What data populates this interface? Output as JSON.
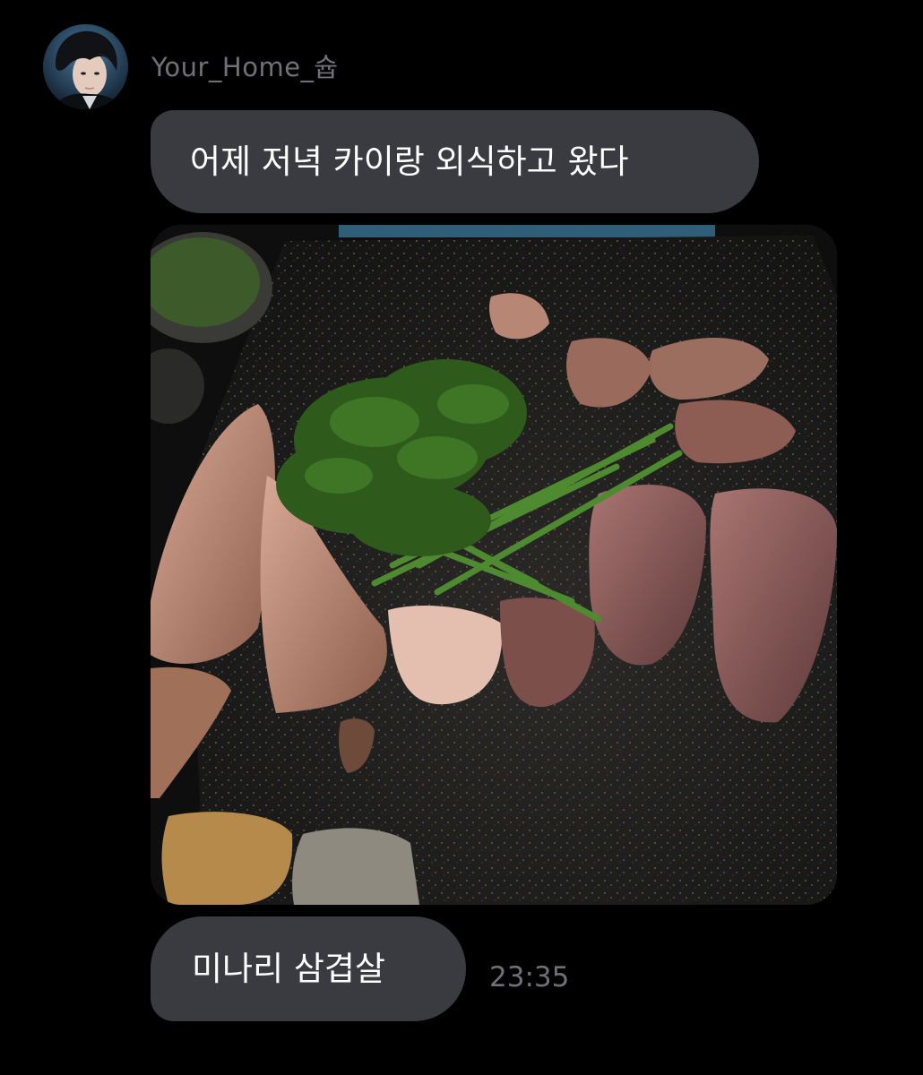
{
  "chat": {
    "sender": {
      "name": "Your_Home_슙",
      "avatar_icon": "avatar"
    },
    "messages": [
      {
        "type": "text",
        "text": "어제 저녁 카이랑 외식하고 왔다"
      },
      {
        "type": "image",
        "icon": "food-photo"
      },
      {
        "type": "text",
        "text": "미나리 삼겹살"
      }
    ],
    "timestamp": "23:35"
  },
  "colors": {
    "background": "#000000",
    "bubble": "#3a3b40",
    "bubble_text": "#ffffff",
    "meta_text": "#6f7176"
  }
}
